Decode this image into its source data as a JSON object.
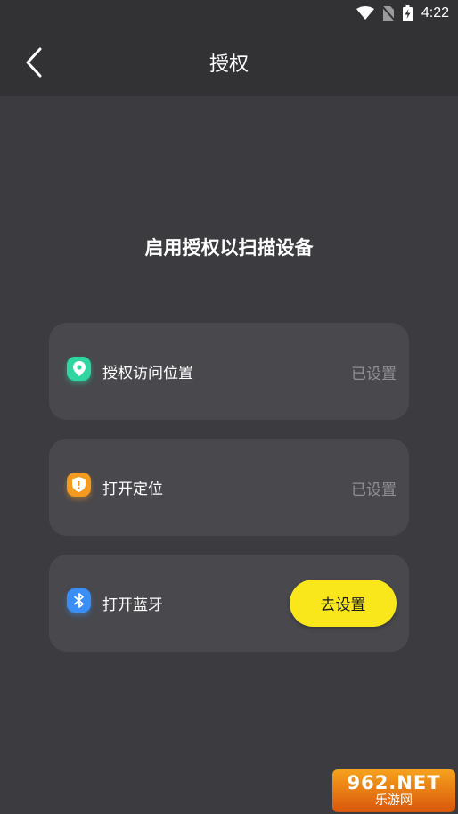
{
  "status_bar": {
    "time": "4:22",
    "icons": [
      "wifi-icon",
      "no-sim-icon",
      "battery-charging-icon"
    ]
  },
  "app_bar": {
    "back_icon": "chevron-left-icon",
    "title": "授权"
  },
  "headline": "启用授权以扫描设备",
  "permissions": [
    {
      "icon": "location-pin-icon",
      "icon_color": "#2fd6a0",
      "label": "授权访问位置",
      "status": "已设置"
    },
    {
      "icon": "shield-exclamation-icon",
      "icon_color": "#f39a1f",
      "label": "打开定位",
      "status": "已设置"
    },
    {
      "icon": "bluetooth-icon",
      "icon_color": "#3b8ef5",
      "label": "打开蓝牙",
      "button_label": "去设置"
    }
  ],
  "watermark": {
    "top": "962.NET",
    "bottom": "乐游网"
  },
  "colors": {
    "background": "#3c3c40",
    "app_bar": "#323235",
    "card": "#48484d",
    "accent_button": "#f9e71c",
    "status_text": "#8f8f94"
  }
}
